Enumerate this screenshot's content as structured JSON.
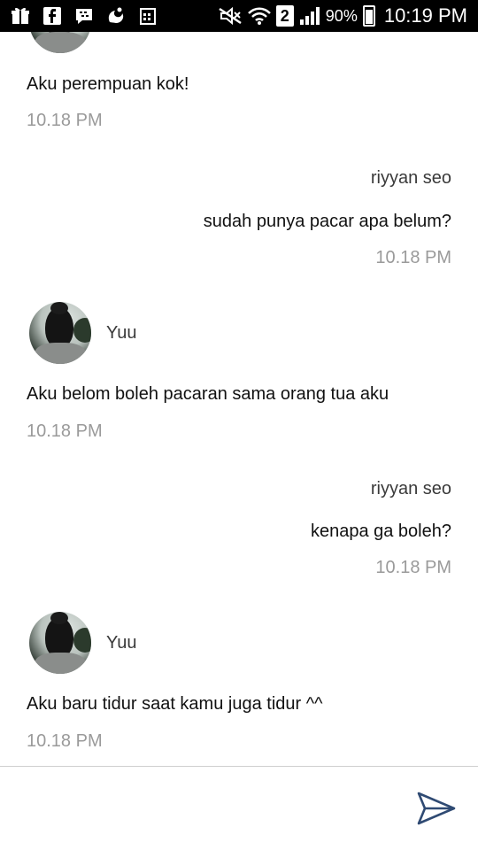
{
  "status_bar": {
    "sim_slot": "2",
    "battery_percent": "90%",
    "time": "10:19 PM",
    "icons": [
      "gift-icon",
      "facebook-icon",
      "bbm-icon",
      "uc-browser-icon",
      "calendar-icon",
      "mute-icon",
      "wifi-icon",
      "signal-icon",
      "battery-icon"
    ]
  },
  "messages": [
    {
      "sender": "",
      "text": "Aku perempuan kok!",
      "time": "10.18 PM",
      "side": "left"
    },
    {
      "sender": "riyyan seo",
      "text": "sudah punya pacar apa belum?",
      "time": "10.18 PM",
      "side": "right"
    },
    {
      "sender": "Yuu",
      "text": "Aku belom boleh pacaran sama orang tua aku",
      "time": "10.18 PM",
      "side": "left"
    },
    {
      "sender": "riyyan seo",
      "text": "kenapa ga boleh?",
      "time": "10.18 PM",
      "side": "right"
    },
    {
      "sender": "Yuu",
      "text": "Aku baru tidur saat kamu juga tidur ^^",
      "time": "10.18 PM",
      "side": "left"
    }
  ],
  "composer": {
    "placeholder": "",
    "value": "",
    "send_icon": "send-icon",
    "accent_color": "#2f4a73"
  }
}
